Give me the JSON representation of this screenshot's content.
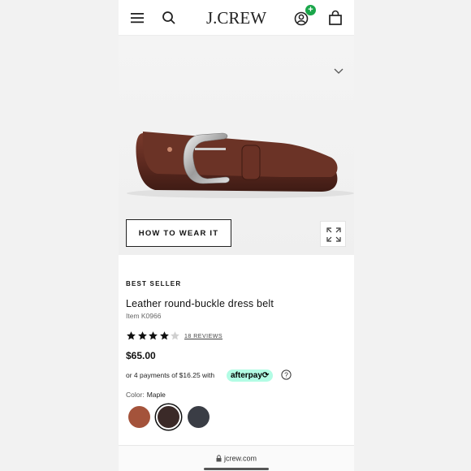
{
  "header": {
    "logo": "J.CREW",
    "account_badge": "+"
  },
  "hero": {
    "how_to_wear_label": "HOW TO WEAR IT"
  },
  "product": {
    "badge": "BEST SELLER",
    "title": "Leather round-buckle dress belt",
    "item_number": "Item K0966",
    "rating": 4,
    "rating_max": 5,
    "reviews_label": "18 REVIEWS",
    "price": "$65.00",
    "installments_text": "or 4 payments of $16.25 with",
    "afterpay_label": "afterpay⟳",
    "color_label": "Color:",
    "color_value": "Maple",
    "swatches": [
      {
        "name": "brown",
        "color": "#a4533b"
      },
      {
        "name": "dark-brown",
        "color": "#3b2a28",
        "selected": true
      },
      {
        "name": "navy",
        "color": "#3a3d45"
      }
    ]
  },
  "browser": {
    "url": "jcrew.com"
  }
}
